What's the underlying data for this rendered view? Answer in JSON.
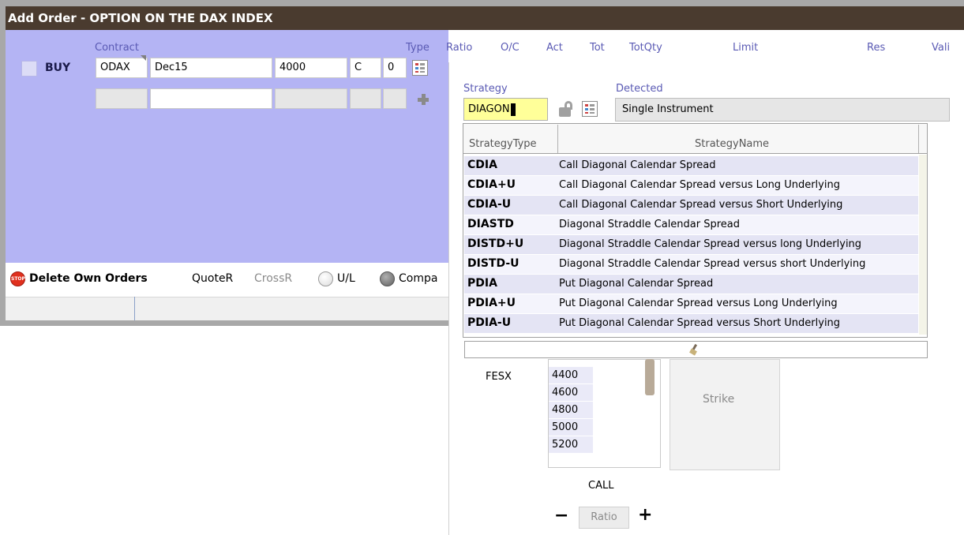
{
  "window": {
    "title": "Add Order - OPTION ON THE DAX INDEX"
  },
  "columns": {
    "contract": "Contract",
    "type": "Type",
    "ratio": "Ratio",
    "oc": "O/C",
    "act": "Act",
    "tot": "Tot",
    "totqty": "TotQty",
    "limit": "Limit",
    "res": "Res",
    "vali": "Vali"
  },
  "order": {
    "side": "BUY",
    "product": "ODAX",
    "expiry": "Dec15",
    "strike": "4000",
    "type": "C",
    "version": "0"
  },
  "toolbar": {
    "stop_icon": "STOP",
    "delete_own_orders": "Delete Own Orders",
    "quoter": "QuoteR",
    "crossr": "CrossR",
    "ul": "U/L",
    "compa": "Compa"
  },
  "strategy": {
    "label": "Strategy",
    "input_value": "DIAGON",
    "detected_label": "Detected",
    "detected_value": "Single Instrument"
  },
  "dropdown": {
    "headers": {
      "type": "StrategyType",
      "name": "StrategyName"
    },
    "rows": [
      {
        "type": "CDIA",
        "name": "Call Diagonal Calendar Spread"
      },
      {
        "type": "CDIA+U",
        "name": "Call Diagonal Calendar Spread versus Long Underlying"
      },
      {
        "type": "CDIA-U",
        "name": "Call Diagonal Calendar Spread versus Short Underlying"
      },
      {
        "type": "DIASTD",
        "name": "Diagonal Straddle Calendar Spread"
      },
      {
        "type": "DISTD+U",
        "name": "Diagonal Straddle Calendar Spread versus long Underlying"
      },
      {
        "type": "DISTD-U",
        "name": "Diagonal Straddle Calendar Spread versus short Underlying"
      },
      {
        "type": "PDIA",
        "name": "Put Diagonal Calendar Spread"
      },
      {
        "type": "PDIA+U",
        "name": "Put Diagonal Calendar Spread versus Long Underlying"
      },
      {
        "type": "PDIA-U",
        "name": "Put Diagonal Calendar Spread versus Short Underlying"
      }
    ]
  },
  "builder": {
    "underlying": "FESX",
    "strikes": [
      "4400",
      "4600",
      "4800",
      "5000",
      "5200"
    ],
    "strike_placeholder": "Strike",
    "option_label": "CALL",
    "minus": "−",
    "ratio_label": "Ratio",
    "plus": "+"
  }
}
